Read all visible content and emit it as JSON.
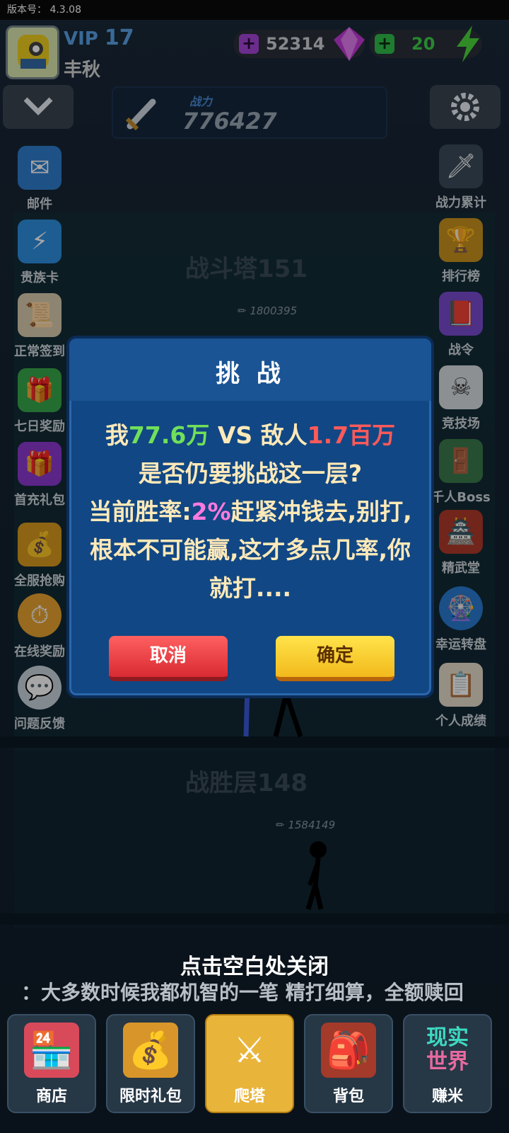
{
  "version": {
    "label": "版本号：",
    "value": "4.3.08"
  },
  "user": {
    "vip_label": "VIP",
    "vip_level": "17",
    "name": "丰秋"
  },
  "resources": {
    "gems": "52314",
    "energy": "20"
  },
  "power": {
    "label": "战力",
    "value": "776427"
  },
  "left_menu": [
    {
      "label": "邮件",
      "icon": "mail-icon"
    },
    {
      "label": "贵族卡",
      "icon": "card-icon"
    },
    {
      "label": "正常签到",
      "icon": "scroll-icon"
    },
    {
      "label": "七日奖励",
      "icon": "gift-icon"
    },
    {
      "label": "首充礼包",
      "icon": "gift-box-icon"
    },
    {
      "label": "全服抢购",
      "icon": "treasure-chest-icon"
    },
    {
      "label": "在线奖励",
      "icon": "stopwatch-icon"
    },
    {
      "label": "问题反馈",
      "icon": "chat-bubble-icon"
    }
  ],
  "right_menu": [
    {
      "label": "战力累计",
      "icon": "sword-icon"
    },
    {
      "label": "排行榜",
      "icon": "trophy-icon"
    },
    {
      "label": "战令",
      "icon": "book-icon"
    },
    {
      "label": "竞技场",
      "icon": "skull-arena-icon"
    },
    {
      "label": "千人Boss",
      "icon": "gate-icon"
    },
    {
      "label": "精武堂",
      "icon": "dojo-icon"
    },
    {
      "label": "幸运转盘",
      "icon": "wheel-icon"
    },
    {
      "label": "个人成绩",
      "icon": "report-icon"
    }
  ],
  "tower": {
    "upper_name": "战斗塔151",
    "upper_power": "1800395",
    "lower_name": "战胜层148",
    "lower_power": "1584149"
  },
  "dialog": {
    "title": "挑 战",
    "line1_a": "我",
    "line1_mine": "77.6万",
    "line1_b": " VS 敌人",
    "line1_enemy": "1.7百万",
    "line2": "是否仍要挑战这一层?",
    "line3_a": "当前胜率:",
    "line3_rate": "2%",
    "line3_b": "赶紧冲钱去,别打,根本不可能赢,这才多点几率,你就打....",
    "cancel": "取消",
    "confirm": "确定"
  },
  "close_hint": "点击空白处关闭",
  "marquee": "：大多数时候我都机智的一笔 精打细算，全额赎回",
  "bottom_nav": [
    {
      "label": "商店",
      "icon": "shop-icon"
    },
    {
      "label": "限时礼包",
      "icon": "treasure-icon"
    },
    {
      "label": "爬塔",
      "icon": "crossed-swords-icon"
    },
    {
      "label": "背包",
      "icon": "backpack-icon"
    },
    {
      "label": "赚米",
      "icon": "real-world-icon",
      "badge_top": "现实",
      "badge_bottom": "世界"
    }
  ]
}
